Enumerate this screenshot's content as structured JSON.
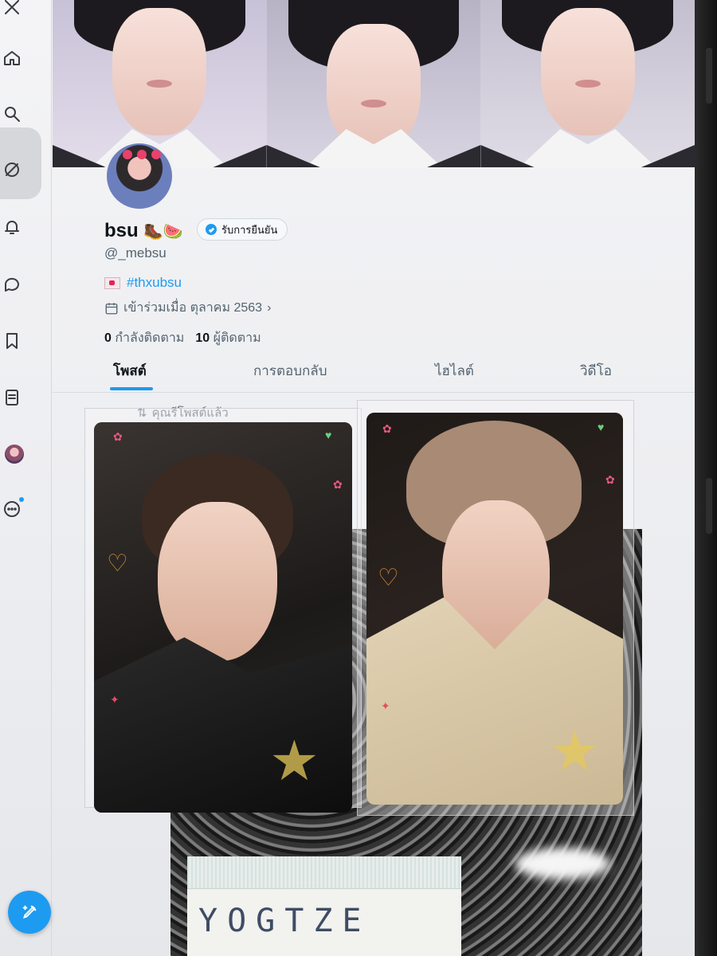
{
  "profile": {
    "display_name": "bsu",
    "name_emoji": "🥾🍉",
    "verify_label": "รับการยืนยัน",
    "handle": "@_mebsu",
    "bio_link": "#thxubsu",
    "joined": "เข้าร่วมเมื่อ ตุลาคม 2563",
    "following_count": "0",
    "following_label": "กำลังติดตาม",
    "followers_count": "10",
    "followers_label": "ผู้ติดตาม"
  },
  "tabs": [
    {
      "label": "โพสต์",
      "active": true
    },
    {
      "label": "การตอบกลับ",
      "active": false
    },
    {
      "label": "ไฮไลต์",
      "active": false
    },
    {
      "label": "วิดีโอ",
      "active": false
    }
  ],
  "feed": {
    "repost_label": "คุณรีโพสต์แล้ว"
  },
  "note": {
    "text": "YOGTZE"
  },
  "colors": {
    "accent": "#1d9bf0",
    "text_primary": "#0f1419",
    "text_secondary": "#536471"
  },
  "icons": [
    "x-logo-icon",
    "home-icon",
    "search-icon",
    "grok-icon",
    "notifications-icon",
    "messages-icon",
    "bookmarks-icon",
    "lists-icon",
    "profile-avatar",
    "more-icon",
    "compose-icon"
  ]
}
